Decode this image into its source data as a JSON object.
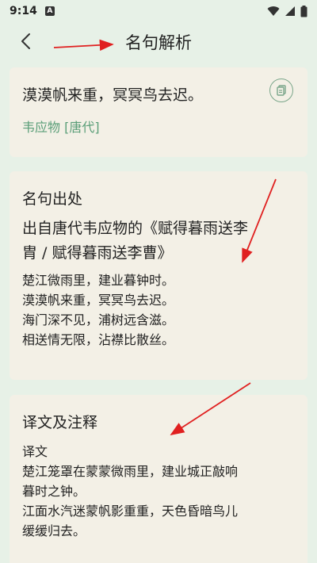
{
  "status": {
    "time": "9:14",
    "notif": "A"
  },
  "header": {
    "title": "名句解析"
  },
  "quote_card": {
    "quote": "漠漠帆来重，冥冥鸟去迟。",
    "author": "韦应物 [唐代]"
  },
  "source_card": {
    "title": "名句出处",
    "source_line1": "出自唐代韦应物的《赋得暮雨送李",
    "source_line2": "胄 / 赋得暮雨送李曹》",
    "poem": [
      "楚江微雨里，建业暮钟时。",
      "漠漠帆来重，冥冥鸟去迟。",
      "海门深不见，浦树远含滋。",
      "相送情无限，沾襟比散丝。"
    ]
  },
  "translation_card": {
    "title": "译文及注释",
    "label": "译文",
    "lines": [
      "楚江笼罩在蒙蒙微雨里，建业城正敲响",
      "暮时之钟。",
      "江面水汽迷蒙帆影重重，天色昏暗鸟儿",
      "缓缓归去。"
    ]
  },
  "colors": {
    "background": "#e7f1e7",
    "card": "#f3f0e6",
    "accent": "#5a9e78",
    "arrow": "#e02020"
  }
}
